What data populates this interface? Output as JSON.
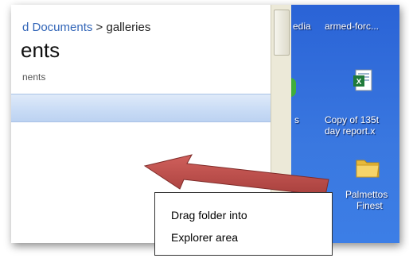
{
  "explorer": {
    "breadcrumb_link": "d Documents",
    "breadcrumb_sep": " > ",
    "breadcrumb_current": "galleries",
    "title": "ents",
    "subtext": "nents"
  },
  "desktop": {
    "top_left_label": "edia",
    "top_right_label": "armed-forc...",
    "excel_label_line1": "Copy of 135t",
    "excel_label_line2": "day report.x",
    "mid_left_label": "s",
    "folder_label_line1": "Palmettos",
    "folder_label_line2": "Finest",
    "folder_left_label": "..."
  },
  "callout": {
    "line1": "Drag folder into",
    "line2": "Explorer area"
  },
  "colors": {
    "arrow_fill": "#c0504d",
    "desktop_blue": "#3a78e0",
    "header_bar": "#c8dbf5"
  },
  "icons": {
    "excel": "excel-file-icon",
    "folder": "folder-icon",
    "arrow": "drag-arrow-icon"
  }
}
